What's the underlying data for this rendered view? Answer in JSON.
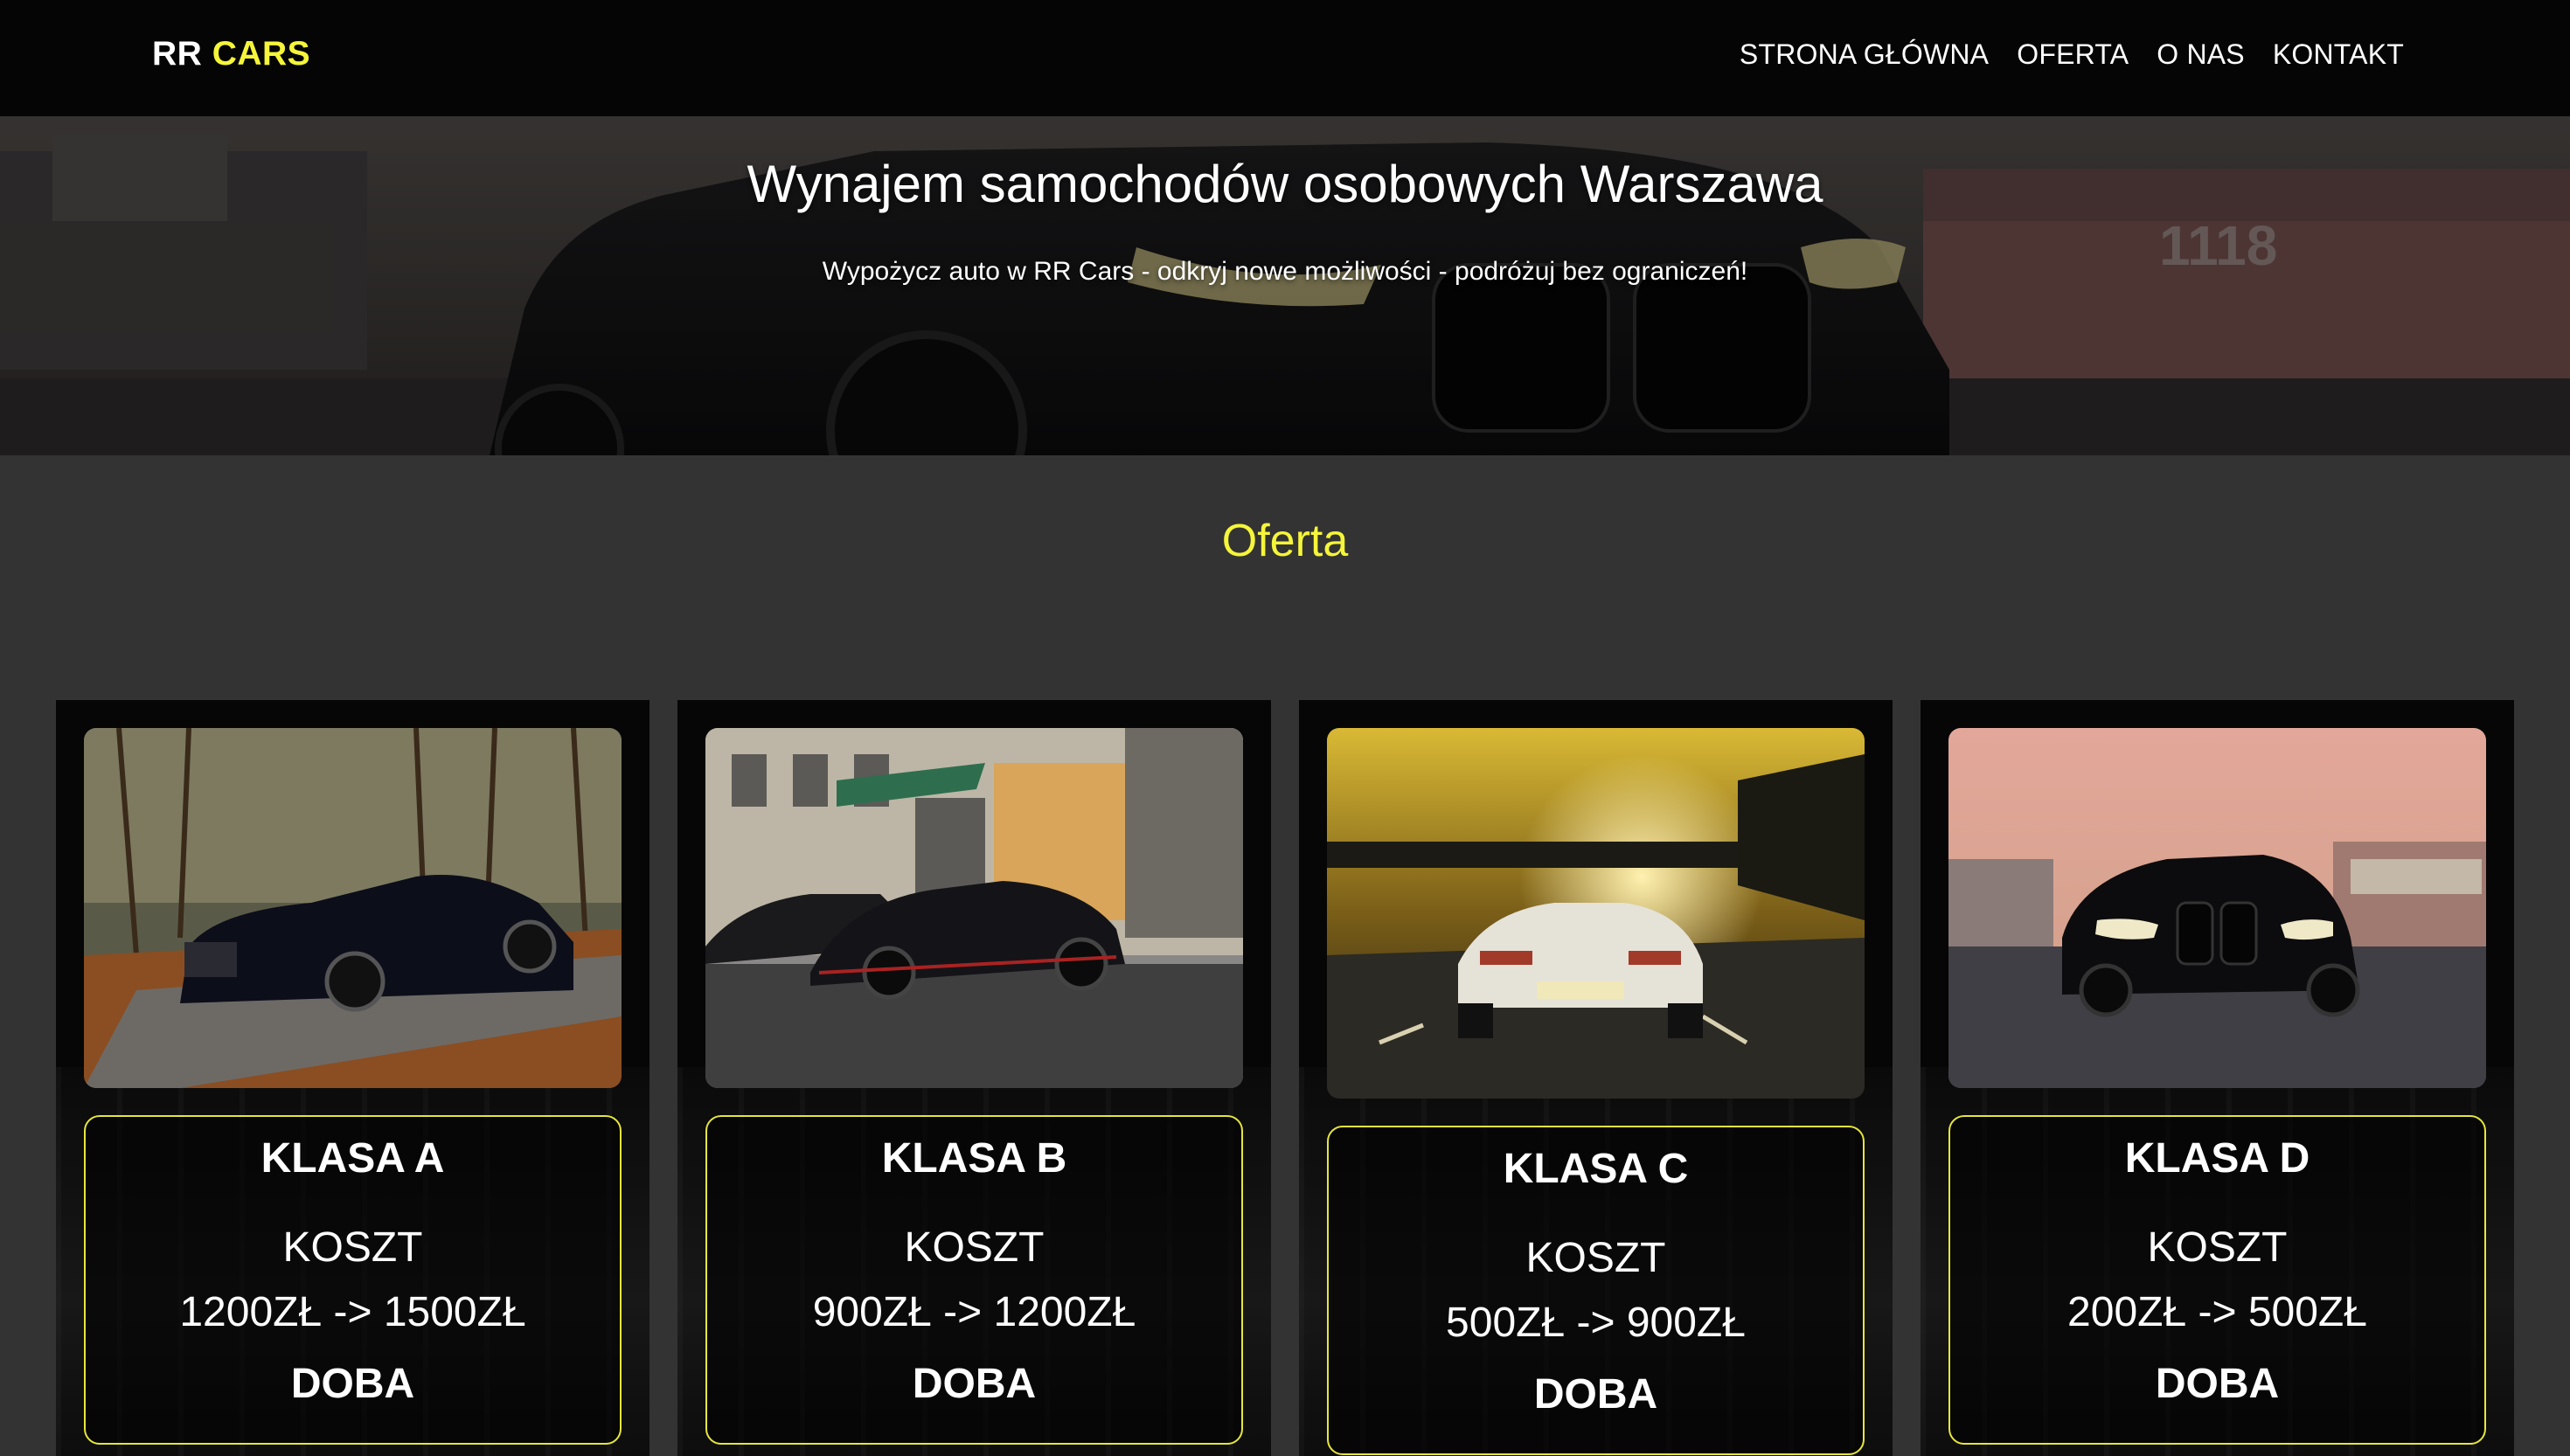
{
  "brand": {
    "part1": "RR",
    "part2": "CARS",
    "accent_color": "#f5f53a"
  },
  "nav": {
    "items": [
      {
        "label": "STRONA GŁÓWNA"
      },
      {
        "label": "OFERTA"
      },
      {
        "label": "O NAS"
      },
      {
        "label": "KONTAKT"
      }
    ]
  },
  "hero": {
    "title": "Wynajem samochodów osobowych Warszawa",
    "subtitle": "Wypożycz auto w RR Cars - odkryj nowe możliwości - podróżuj bez ograniczeń!",
    "background_sign": "1118"
  },
  "offer": {
    "title": "Oferta",
    "cards": [
      {
        "class_label": "KLASA A",
        "cost_label": "KOSZT",
        "price": "1200ZŁ -> 1500ZŁ",
        "period": "DOBA",
        "image": "black-sedan-autumn-forest"
      },
      {
        "class_label": "KLASA B",
        "cost_label": "KOSZT",
        "price": "900ZŁ -> 1200ZŁ",
        "period": "DOBA",
        "image": "supercar-city-street"
      },
      {
        "class_label": "KLASA C",
        "cost_label": "KOSZT",
        "price": "500ZŁ -> 900ZŁ",
        "period": "DOBA",
        "image": "white-sportscar-sunset-highway"
      },
      {
        "class_label": "KLASA D",
        "cost_label": "KOSZT",
        "price": "200ZŁ -> 500ZŁ",
        "period": "DOBA",
        "image": "black-coupe-dusk-parking"
      }
    ]
  }
}
